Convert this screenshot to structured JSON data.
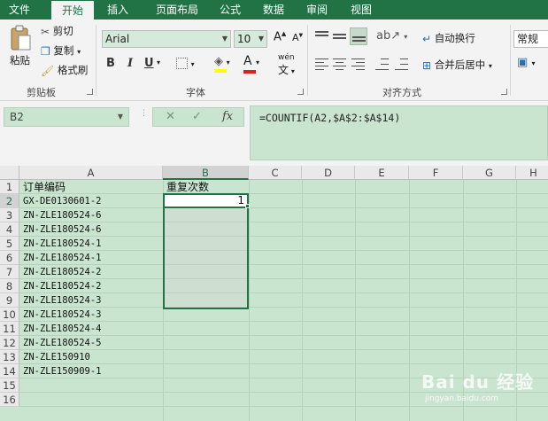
{
  "ribbon_tabs": [
    "文件",
    "开始",
    "插入",
    "页面布局",
    "公式",
    "数据",
    "审阅",
    "视图"
  ],
  "active_tab": "开始",
  "clipboard": {
    "paste_label": "粘贴",
    "cut_label": "剪切",
    "copy_label": "复制",
    "format_painter_label": "格式刷",
    "group_label": "剪贴板"
  },
  "font": {
    "name": "Arial",
    "size": "10",
    "group_label": "字体",
    "bold": "B",
    "italic": "I",
    "underline": "U",
    "grow_font": "A",
    "shrink_font": "A",
    "font_color_letter": "A",
    "phonetic_label": "wén"
  },
  "alignment": {
    "wrap_text_label": "自动换行",
    "merge_center_label": "合并后居中",
    "group_label": "对齐方式"
  },
  "number": {
    "format_value": "常规"
  },
  "formula_bar": {
    "name_box": "B2",
    "cancel": "✕",
    "enter": "✓",
    "fx": "fx",
    "formula": "=COUNTIF(A2,$A$2:$A$14)"
  },
  "sheet": {
    "columns": [
      "A",
      "B",
      "C",
      "D",
      "E",
      "F",
      "G",
      "H"
    ],
    "selected_column": "B",
    "rows": [
      "1",
      "2",
      "3",
      "4",
      "5",
      "6",
      "7",
      "8",
      "9",
      "10",
      "11",
      "12",
      "13",
      "14",
      "15",
      "16"
    ],
    "selected_row": "2",
    "header_a": "订单编码",
    "header_b": "重复次数",
    "column_a_values": [
      "GX-DE0130601-2",
      "ZN-ZLE180524-6",
      "ZN-ZLE180524-6",
      "ZN-ZLE180524-1",
      "ZN-ZLE180524-1",
      "ZN-ZLE180524-2",
      "ZN-ZLE180524-2",
      "ZN-ZLE180524-3",
      "ZN-ZLE180524-3",
      "ZN-ZLE180524-4",
      "ZN-ZLE180524-5",
      "ZN-ZLE150910",
      "ZN-ZLE150909-1"
    ],
    "b2_value": "1"
  },
  "watermark": {
    "text": "Bai du 经验",
    "url_text": "jingyan.baidu.com"
  },
  "colors": {
    "excel_green": "#217346",
    "cell_bg": "#c9e4cf"
  }
}
